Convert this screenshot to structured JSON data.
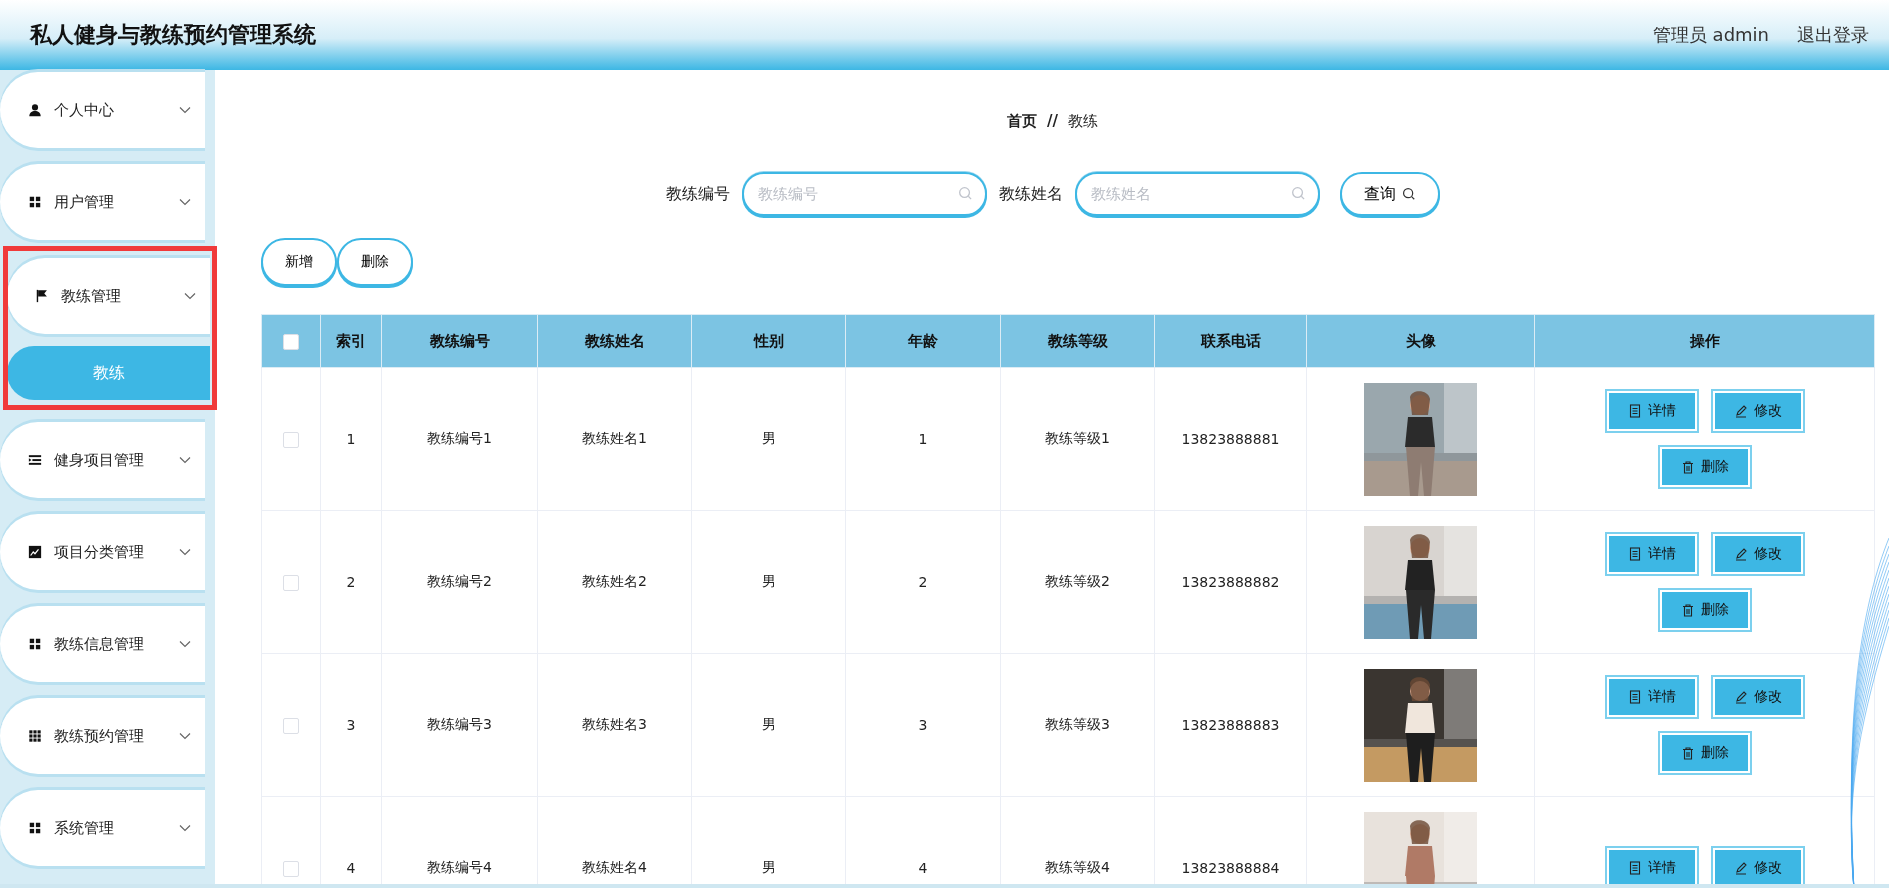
{
  "header": {
    "title": "私人健身与教练预约管理系统",
    "user": "管理员 admin",
    "logout": "退出登录"
  },
  "sidebar": {
    "items": [
      {
        "label": "个人中心",
        "highlighted": false
      },
      {
        "label": "用户管理",
        "highlighted": false
      },
      {
        "label": "教练管理",
        "highlighted": true,
        "children": [
          {
            "label": "教练",
            "selected": true
          }
        ]
      },
      {
        "label": "健身项目管理",
        "highlighted": false
      },
      {
        "label": "项目分类管理",
        "highlighted": false
      },
      {
        "label": "教练信息管理",
        "highlighted": false
      },
      {
        "label": "教练预约管理",
        "highlighted": false
      },
      {
        "label": "系统管理",
        "highlighted": false
      }
    ]
  },
  "breadcrumb": {
    "items": [
      "首页",
      "教练"
    ],
    "separator": "//"
  },
  "search": {
    "fields": [
      {
        "label": "教练编号",
        "placeholder": "教练编号"
      },
      {
        "label": "教练姓名",
        "placeholder": "教练姓名"
      }
    ],
    "button": "查询"
  },
  "toolbar": [
    "新增",
    "删除"
  ],
  "table": {
    "header_checked": false,
    "columns": [
      "索引",
      "教练编号",
      "教练姓名",
      "性别",
      "年龄",
      "教练等级",
      "联系电话",
      "头像",
      "操作"
    ],
    "rows": [
      {
        "checked": false,
        "cells": [
          "1",
          "教练编号1",
          "教练姓名1",
          "男",
          "1",
          "教练等级1",
          "13823888881"
        ],
        "photo": {
          "kind": "picture"
        },
        "actions": [
          "详情",
          "修改",
          "删除"
        ]
      },
      {
        "checked": false,
        "cells": [
          "2",
          "教练编号2",
          "教练姓名2",
          "男",
          "2",
          "教练等级2",
          "13823888882"
        ],
        "photo": {
          "kind": "picture"
        },
        "actions": [
          "详情",
          "修改",
          "删除"
        ]
      },
      {
        "checked": false,
        "cells": [
          "3",
          "教练编号3",
          "教练姓名3",
          "男",
          "3",
          "教练等级3",
          "13823888883"
        ],
        "photo": {
          "kind": "picture"
        },
        "actions": [
          "详情",
          "修改",
          "删除"
        ]
      },
      {
        "checked": false,
        "cells": [
          "4",
          "教练编号4",
          "教练姓名4",
          "男",
          "4",
          "教练等级4",
          "13823888884"
        ],
        "photo": {
          "kind": "picture"
        },
        "actions": [
          "详情",
          "修改"
        ]
      }
    ]
  }
}
